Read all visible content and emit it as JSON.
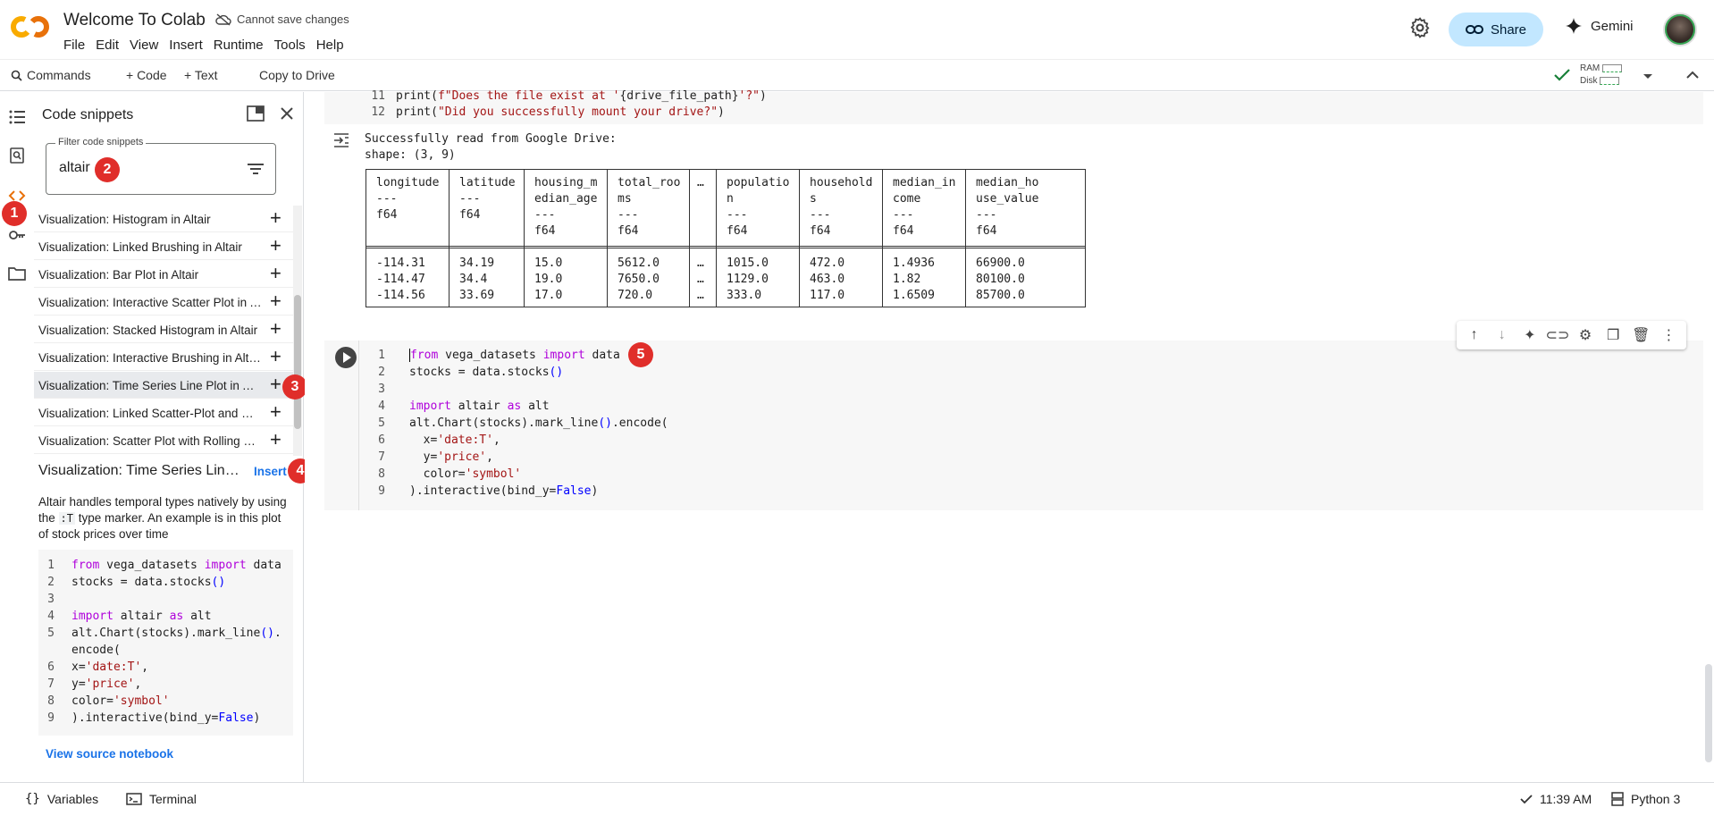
{
  "header": {
    "title": "Welcome To Colab",
    "save_status": "Cannot save changes",
    "menu": [
      "File",
      "Edit",
      "View",
      "Insert",
      "Runtime",
      "Tools",
      "Help"
    ],
    "share_label": "Share",
    "gemini_label": "Gemini"
  },
  "toolbar": {
    "commands": "Commands",
    "add_code": "+ Code",
    "add_text": "+ Text",
    "copy_to_drive": "Copy to Drive",
    "ram": "RAM",
    "disk": "Disk"
  },
  "panel": {
    "title": "Code snippets",
    "filter_label": "Filter code snippets",
    "filter_value": "altair",
    "snippets": [
      "Visualization: Histogram in Altair",
      "Visualization: Linked Brushing in Altair",
      "Visualization: Bar Plot in Altair",
      "Visualization: Interactive Scatter Plot in Altair",
      "Visualization: Stacked Histogram in Altair",
      "Visualization: Interactive Brushing in Altair",
      "Visualization: Time Series Line Plot in Altair",
      "Visualization: Linked Scatter-Plot and Histogram in Altair",
      "Visualization: Scatter Plot with Rolling Mean in Altair"
    ],
    "selected_index": 6,
    "detail_title": "Visualization: Time Series Line Plot in Altair",
    "insert_label": "Insert",
    "description_pre": "Altair handles temporal types natively by using the",
    "description_code": ":T",
    "description_post": "type marker. An example is in this plot of stock prices over time",
    "view_source": "View source notebook",
    "code_lines": [
      {
        "n": "1",
        "t": "from vega_datasets import data"
      },
      {
        "n": "2",
        "t": "stocks = data.stocks()"
      },
      {
        "n": "3",
        "t": ""
      },
      {
        "n": "4",
        "t": "import altair as alt"
      },
      {
        "n": "5",
        "t": "alt.Chart(stocks).mark_line()."
      },
      {
        "n": "",
        "t": "encode("
      },
      {
        "n": "6",
        "t": "  x='date:T',"
      },
      {
        "n": "7",
        "t": "  y='price',"
      },
      {
        "n": "8",
        "t": "  color='symbol'"
      },
      {
        "n": "9",
        "t": ").interactive(bind_y=False)"
      }
    ]
  },
  "notebook": {
    "prev_lines": [
      {
        "n": "11",
        "t": "print(f\"Does the file exist at '{drive_file_path}'?\")"
      },
      {
        "n": "12",
        "t": "print(\"Did you successfully mount your drive?\")"
      }
    ],
    "output_line1": "Successfully read from Google Drive:",
    "output_line2": "shape: (3, 9)",
    "df_columns": [
      {
        "h": "longitude\n---\nf64",
        "c": [
          "-114.31",
          "-114.47",
          "-114.56"
        ]
      },
      {
        "h": "latitude\n---\nf64",
        "c": [
          "34.19",
          "34.4",
          "33.69"
        ]
      },
      {
        "h": "housing_m\nedian_age\n---\nf64",
        "c": [
          "15.0",
          "19.0",
          "17.0"
        ]
      },
      {
        "h": "total_roo\nms\n---\nf64",
        "c": [
          "5612.0",
          "7650.0",
          "720.0"
        ]
      },
      {
        "h": "…",
        "c": [
          "…",
          "…",
          "…"
        ]
      },
      {
        "h": "populatio\nn\n---\nf64",
        "c": [
          "1015.0",
          "1129.0",
          "333.0"
        ]
      },
      {
        "h": "household\ns\n---\nf64",
        "c": [
          "472.0",
          "463.0",
          "117.0"
        ]
      },
      {
        "h": "median_in\ncome\n---\nf64",
        "c": [
          "1.4936",
          "1.82",
          "1.6509"
        ]
      },
      {
        "h": "median_ho\nuse_value\n---\nf64",
        "c": [
          "66900.0",
          "80100.0",
          "85700.0"
        ]
      }
    ],
    "cell_lines": [
      {
        "n": "1",
        "t": "from vega_datasets import data"
      },
      {
        "n": "2",
        "t": "stocks = data.stocks()"
      },
      {
        "n": "3",
        "t": ""
      },
      {
        "n": "4",
        "t": "import altair as alt"
      },
      {
        "n": "5",
        "t": "alt.Chart(stocks).mark_line().encode("
      },
      {
        "n": "6",
        "t": "  x='date:T',"
      },
      {
        "n": "7",
        "t": "  y='price',"
      },
      {
        "n": "8",
        "t": "  color='symbol'"
      },
      {
        "n": "9",
        "t": ").interactive(bind_y=False)"
      }
    ]
  },
  "markers": [
    "1",
    "2",
    "3",
    "4",
    "5"
  ],
  "statusbar": {
    "variables": "Variables",
    "terminal": "Terminal",
    "time": "11:39 AM",
    "kernel": "Python 3"
  },
  "colors": {
    "accent": "#1a73e8",
    "share_bg": "#c2e7ff",
    "marker": "#e02e2a",
    "keyword": "#af00db",
    "string": "#a31515"
  }
}
